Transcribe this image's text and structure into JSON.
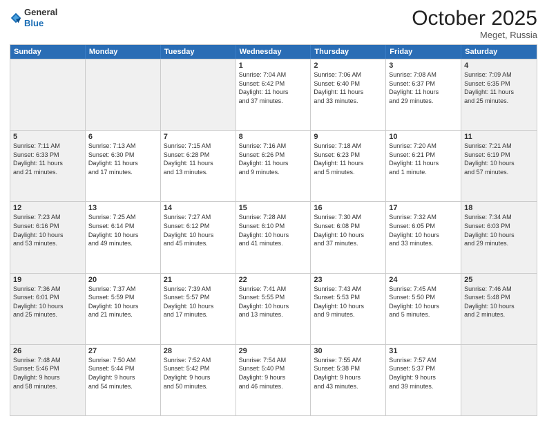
{
  "header": {
    "logo_general": "General",
    "logo_blue": "Blue",
    "month_title": "October 2025",
    "location": "Meget, Russia"
  },
  "days_of_week": [
    "Sunday",
    "Monday",
    "Tuesday",
    "Wednesday",
    "Thursday",
    "Friday",
    "Saturday"
  ],
  "weeks": [
    [
      {
        "day": "",
        "info": "",
        "shaded": true
      },
      {
        "day": "",
        "info": "",
        "shaded": true
      },
      {
        "day": "",
        "info": "",
        "shaded": true
      },
      {
        "day": "1",
        "info": "Sunrise: 7:04 AM\nSunset: 6:42 PM\nDaylight: 11 hours\nand 37 minutes.",
        "shaded": false
      },
      {
        "day": "2",
        "info": "Sunrise: 7:06 AM\nSunset: 6:40 PM\nDaylight: 11 hours\nand 33 minutes.",
        "shaded": false
      },
      {
        "day": "3",
        "info": "Sunrise: 7:08 AM\nSunset: 6:37 PM\nDaylight: 11 hours\nand 29 minutes.",
        "shaded": false
      },
      {
        "day": "4",
        "info": "Sunrise: 7:09 AM\nSunset: 6:35 PM\nDaylight: 11 hours\nand 25 minutes.",
        "shaded": true
      }
    ],
    [
      {
        "day": "5",
        "info": "Sunrise: 7:11 AM\nSunset: 6:33 PM\nDaylight: 11 hours\nand 21 minutes.",
        "shaded": true
      },
      {
        "day": "6",
        "info": "Sunrise: 7:13 AM\nSunset: 6:30 PM\nDaylight: 11 hours\nand 17 minutes.",
        "shaded": false
      },
      {
        "day": "7",
        "info": "Sunrise: 7:15 AM\nSunset: 6:28 PM\nDaylight: 11 hours\nand 13 minutes.",
        "shaded": false
      },
      {
        "day": "8",
        "info": "Sunrise: 7:16 AM\nSunset: 6:26 PM\nDaylight: 11 hours\nand 9 minutes.",
        "shaded": false
      },
      {
        "day": "9",
        "info": "Sunrise: 7:18 AM\nSunset: 6:23 PM\nDaylight: 11 hours\nand 5 minutes.",
        "shaded": false
      },
      {
        "day": "10",
        "info": "Sunrise: 7:20 AM\nSunset: 6:21 PM\nDaylight: 11 hours\nand 1 minute.",
        "shaded": false
      },
      {
        "day": "11",
        "info": "Sunrise: 7:21 AM\nSunset: 6:19 PM\nDaylight: 10 hours\nand 57 minutes.",
        "shaded": true
      }
    ],
    [
      {
        "day": "12",
        "info": "Sunrise: 7:23 AM\nSunset: 6:16 PM\nDaylight: 10 hours\nand 53 minutes.",
        "shaded": true
      },
      {
        "day": "13",
        "info": "Sunrise: 7:25 AM\nSunset: 6:14 PM\nDaylight: 10 hours\nand 49 minutes.",
        "shaded": false
      },
      {
        "day": "14",
        "info": "Sunrise: 7:27 AM\nSunset: 6:12 PM\nDaylight: 10 hours\nand 45 minutes.",
        "shaded": false
      },
      {
        "day": "15",
        "info": "Sunrise: 7:28 AM\nSunset: 6:10 PM\nDaylight: 10 hours\nand 41 minutes.",
        "shaded": false
      },
      {
        "day": "16",
        "info": "Sunrise: 7:30 AM\nSunset: 6:08 PM\nDaylight: 10 hours\nand 37 minutes.",
        "shaded": false
      },
      {
        "day": "17",
        "info": "Sunrise: 7:32 AM\nSunset: 6:05 PM\nDaylight: 10 hours\nand 33 minutes.",
        "shaded": false
      },
      {
        "day": "18",
        "info": "Sunrise: 7:34 AM\nSunset: 6:03 PM\nDaylight: 10 hours\nand 29 minutes.",
        "shaded": true
      }
    ],
    [
      {
        "day": "19",
        "info": "Sunrise: 7:36 AM\nSunset: 6:01 PM\nDaylight: 10 hours\nand 25 minutes.",
        "shaded": true
      },
      {
        "day": "20",
        "info": "Sunrise: 7:37 AM\nSunset: 5:59 PM\nDaylight: 10 hours\nand 21 minutes.",
        "shaded": false
      },
      {
        "day": "21",
        "info": "Sunrise: 7:39 AM\nSunset: 5:57 PM\nDaylight: 10 hours\nand 17 minutes.",
        "shaded": false
      },
      {
        "day": "22",
        "info": "Sunrise: 7:41 AM\nSunset: 5:55 PM\nDaylight: 10 hours\nand 13 minutes.",
        "shaded": false
      },
      {
        "day": "23",
        "info": "Sunrise: 7:43 AM\nSunset: 5:53 PM\nDaylight: 10 hours\nand 9 minutes.",
        "shaded": false
      },
      {
        "day": "24",
        "info": "Sunrise: 7:45 AM\nSunset: 5:50 PM\nDaylight: 10 hours\nand 5 minutes.",
        "shaded": false
      },
      {
        "day": "25",
        "info": "Sunrise: 7:46 AM\nSunset: 5:48 PM\nDaylight: 10 hours\nand 2 minutes.",
        "shaded": true
      }
    ],
    [
      {
        "day": "26",
        "info": "Sunrise: 7:48 AM\nSunset: 5:46 PM\nDaylight: 9 hours\nand 58 minutes.",
        "shaded": true
      },
      {
        "day": "27",
        "info": "Sunrise: 7:50 AM\nSunset: 5:44 PM\nDaylight: 9 hours\nand 54 minutes.",
        "shaded": false
      },
      {
        "day": "28",
        "info": "Sunrise: 7:52 AM\nSunset: 5:42 PM\nDaylight: 9 hours\nand 50 minutes.",
        "shaded": false
      },
      {
        "day": "29",
        "info": "Sunrise: 7:54 AM\nSunset: 5:40 PM\nDaylight: 9 hours\nand 46 minutes.",
        "shaded": false
      },
      {
        "day": "30",
        "info": "Sunrise: 7:55 AM\nSunset: 5:38 PM\nDaylight: 9 hours\nand 43 minutes.",
        "shaded": false
      },
      {
        "day": "31",
        "info": "Sunrise: 7:57 AM\nSunset: 5:37 PM\nDaylight: 9 hours\nand 39 minutes.",
        "shaded": false
      },
      {
        "day": "",
        "info": "",
        "shaded": true
      }
    ]
  ]
}
